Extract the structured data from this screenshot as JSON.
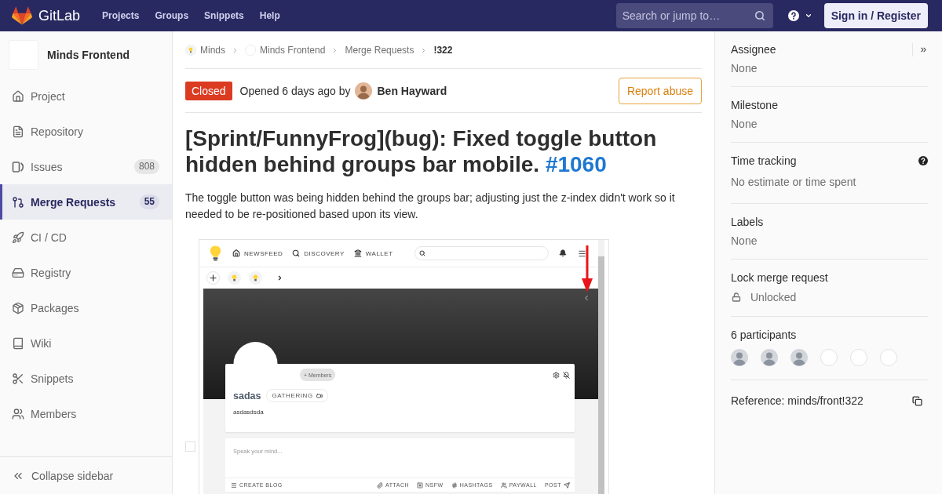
{
  "top_bar": {
    "logo": "GitLab",
    "nav": [
      "Projects",
      "Groups",
      "Snippets",
      "Help"
    ],
    "search": {
      "placeholder": "Search or jump to…"
    },
    "sign_in_button": "Sign in / Register"
  },
  "sidebar": {
    "project": "Minds Frontend",
    "items": [
      {
        "label": "Project",
        "selected": false
      },
      {
        "label": "Repository",
        "selected": false
      },
      {
        "label": "Issues",
        "count": "808",
        "selected": false
      },
      {
        "label": "Merge Requests",
        "count": "55",
        "selected": true
      },
      {
        "label": "CI / CD",
        "selected": false
      },
      {
        "label": "Registry",
        "selected": false
      },
      {
        "label": "Packages",
        "selected": false
      },
      {
        "label": "Wiki",
        "selected": false
      },
      {
        "label": "Snippets",
        "selected": false
      },
      {
        "label": "Members",
        "selected": false
      }
    ],
    "collapse": "Collapse sidebar"
  },
  "breadcrumbs": [
    {
      "label": "Minds",
      "kind": "group"
    },
    {
      "label": "Minds Frontend",
      "kind": "project"
    },
    {
      "label": "Merge Requests",
      "kind": "page"
    },
    {
      "label": "!322",
      "kind": "current"
    }
  ],
  "merge_request": {
    "status": "Closed",
    "opened": "Opened 6 days ago by",
    "author": "Ben Hayward",
    "report_button": "Report abuse",
    "title": "[Sprint/FunnyFrog](bug): Fixed toggle button hidden behind groups bar mobile.",
    "title_link": "#1060",
    "description": "The toggle button was being hidden behind the groups bar; adjusting just the z-index didn't work so it needed to be re-positioned based upon its view."
  },
  "screenshot": {
    "nav": [
      "NEWSFEED",
      "DISCOVERY",
      "WALLET"
    ],
    "members_button": "+ Members",
    "group_name": "sadas",
    "tag": "GATHERING",
    "group_description": "asdasdsda",
    "composer": {
      "placeholder": "Speak your mind...",
      "actions": [
        "CREATE BLOG",
        "ATTACH",
        "NSFW",
        "HASHTAGS",
        "PAYWALL",
        "POST"
      ]
    }
  },
  "right_sidebar": {
    "assignee": {
      "title": "Assignee",
      "value": "None"
    },
    "milestone": {
      "title": "Milestone",
      "value": "None"
    },
    "time_tracking": {
      "title": "Time tracking",
      "value": "No estimate or time spent"
    },
    "labels": {
      "title": "Labels",
      "value": "None"
    },
    "lock": {
      "title": "Lock merge request",
      "value": "Unlocked",
      "locked": false
    },
    "participants": {
      "title": "6 participants",
      "avatars": [
        {
          "kind": "photo"
        },
        {
          "kind": "photo"
        },
        {
          "kind": "photo"
        },
        {
          "kind": "blank"
        },
        {
          "kind": "blank"
        },
        {
          "kind": "blank"
        }
      ]
    },
    "reference": "Reference: minds/front!322"
  }
}
